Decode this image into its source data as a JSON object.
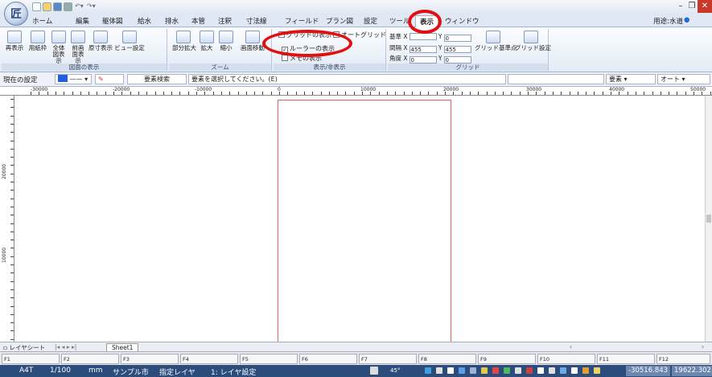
{
  "title_bar": {
    "app_letter": "匠",
    "min": "–",
    "restore": "❐",
    "close": "✕"
  },
  "tabs": [
    "ホーム",
    "編集",
    "躯体図",
    "給水",
    "排水",
    "本管",
    "注釈",
    "寸法線",
    "フィールド",
    "プラン図",
    "設定",
    "ツール",
    "表示",
    "ウィンドウ"
  ],
  "active_tab": "表示",
  "usage_label": "用途:水道",
  "ribbon": {
    "drawing_buttons": [
      "再表示",
      "用紙枠",
      "全体図表示",
      "前画面表示",
      "原寸表示",
      "ビュー設定"
    ],
    "drawing_caption": "図面の表示",
    "zoom_buttons": [
      "部分拡大",
      "拡大",
      "縮小",
      "画面移動"
    ],
    "zoom_caption": "ズーム",
    "show_checks": [
      {
        "label": "グリッドの表示",
        "checked": false
      },
      {
        "label": "オートグリッド",
        "checked": false
      },
      {
        "label": "ルーラーの表示",
        "checked": true
      },
      {
        "label": "メモの表示",
        "checked": false
      }
    ],
    "show_caption": "表示/非表示",
    "grid_fields": {
      "base_label": "基準",
      "base_x": "",
      "base_y": "0",
      "spacing_label": "間隔",
      "spacing_x": "455",
      "spacing_y": "455",
      "angle_label": "角度",
      "angle_x": "0",
      "angle_y": "0",
      "xl": "X",
      "yl": "Y"
    },
    "grid_buttons": [
      "グリッド基準点",
      "グリッド設定"
    ],
    "grid_caption": "グリッド"
  },
  "settings_bar": {
    "current_setting": "現在の設定",
    "element_search": "要素検索",
    "prompt": "要素を選択してください。(E)",
    "element_dropdown": "要素",
    "auto_dropdown": "オート"
  },
  "ruler": {
    "h_labels": [
      "-30000",
      "-20000",
      "-10000",
      "0",
      "10000",
      "20000",
      "30000",
      "40000",
      "50000"
    ],
    "v_labels": [
      "20000",
      "10000"
    ]
  },
  "sheet_bar": {
    "layer_sheet": "レイヤシート",
    "nav": "|◂ ◂ ▸ ▸|",
    "sheet_name": "Sheet1"
  },
  "function_keys": [
    "F1",
    "F2",
    "F3",
    "F4",
    "F5",
    "F6",
    "F7",
    "F8",
    "F9",
    "F10",
    "F11",
    "F12"
  ],
  "status": {
    "paper": "A4T",
    "scale": "1/100",
    "unit": "mm",
    "city": "サンプル市",
    "layer_mode": "指定レイヤ",
    "layer": "1: レイヤ設定",
    "angle": "45°",
    "coord_x": "-30516.843",
    "coord_y": "19622.302"
  },
  "colors": {
    "highlight": "#e01010",
    "paper_border": "#e06060",
    "status_bg": "#2c4c7c",
    "current_color": "#1f5fe0"
  }
}
